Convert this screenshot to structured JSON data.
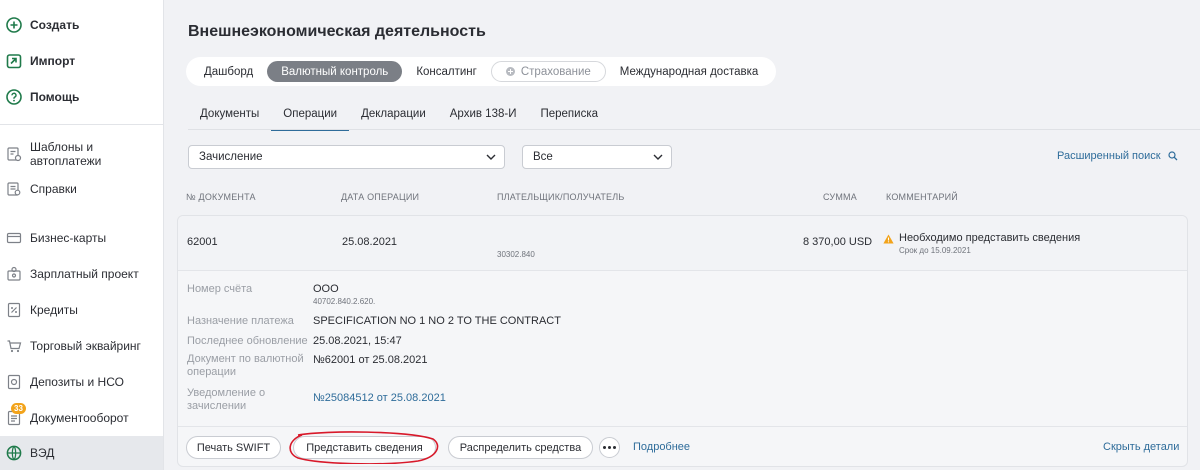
{
  "sidebar": {
    "items": [
      {
        "label": "Создать",
        "icon": "plus-circle-icon"
      },
      {
        "label": "Импорт",
        "icon": "import-icon"
      },
      {
        "label": "Помощь",
        "icon": "help-icon"
      },
      {
        "label": "Шаблоны и автоплатежи",
        "icon": "templates-icon"
      },
      {
        "label": "Справки",
        "icon": "certificates-icon"
      },
      {
        "label": "Бизнес-карты",
        "icon": "card-icon"
      },
      {
        "label": "Зарплатный проект",
        "icon": "salary-icon"
      },
      {
        "label": "Кредиты",
        "icon": "credit-icon"
      },
      {
        "label": "Торговый эквайринг",
        "icon": "cart-icon"
      },
      {
        "label": "Депозиты и НСО",
        "icon": "deposit-icon"
      },
      {
        "label": "Документооборот",
        "icon": "documents-icon",
        "badge": "33"
      },
      {
        "label": "ВЭД",
        "icon": "globe-icon"
      }
    ]
  },
  "header": {
    "title": "Внешнеэкономическая деятельность"
  },
  "pills": [
    "Дашборд",
    "Валютный контроль",
    "Консалтинг",
    "Страхование",
    "Международная доставка"
  ],
  "tabs": [
    "Документы",
    "Операции",
    "Декларации",
    "Архив 138-И",
    "Переписка"
  ],
  "filters": {
    "type": "Зачисление",
    "status": "Все",
    "advanced_search": "Расширенный поиск"
  },
  "table": {
    "headers": [
      "№ ДОКУМЕНТА",
      "ДАТА ОПЕРАЦИИ",
      "ПЛАТЕЛЬЩИК/ПОЛУЧАТЕЛЬ",
      "СУММА",
      "КОММЕНТАРИЙ"
    ]
  },
  "operation": {
    "doc_number": "62001",
    "date": "25.08.2021",
    "payer_account": "30302.840",
    "amount": "8 370,00 USD",
    "warning": "Необходимо представить сведения",
    "deadline": "Срок до 15.09.2021"
  },
  "details": {
    "account_label": "Номер счёта",
    "account_name": "ООО",
    "account_number": "40702.840.2.620.",
    "purpose_label": "Назначение платежа",
    "purpose": "SPECIFICATION NO 1 NO 2 TO THE CONTRACT",
    "updated_label": "Последнее обновление",
    "updated": "25.08.2021, 15:47",
    "doc_label_1": "Документ по валютной",
    "doc_label_2": "операции",
    "doc": "№62001 от 25.08.2021",
    "notice_label_1": "Уведомление о",
    "notice_label_2": "зачислении",
    "notice": "№25084512 от 25.08.2021"
  },
  "actions": {
    "print_swift": "Печать SWIFT",
    "submit_info": "Представить сведения",
    "distribute_funds": "Распределить средства",
    "more_details": "Подробнее",
    "hide_details": "Скрыть детали"
  },
  "colors": {
    "accent": "#2e6c9a",
    "active_pill": "#7b7f86",
    "warning": "#f2a31b",
    "annotation_oval": "#d8192a"
  }
}
